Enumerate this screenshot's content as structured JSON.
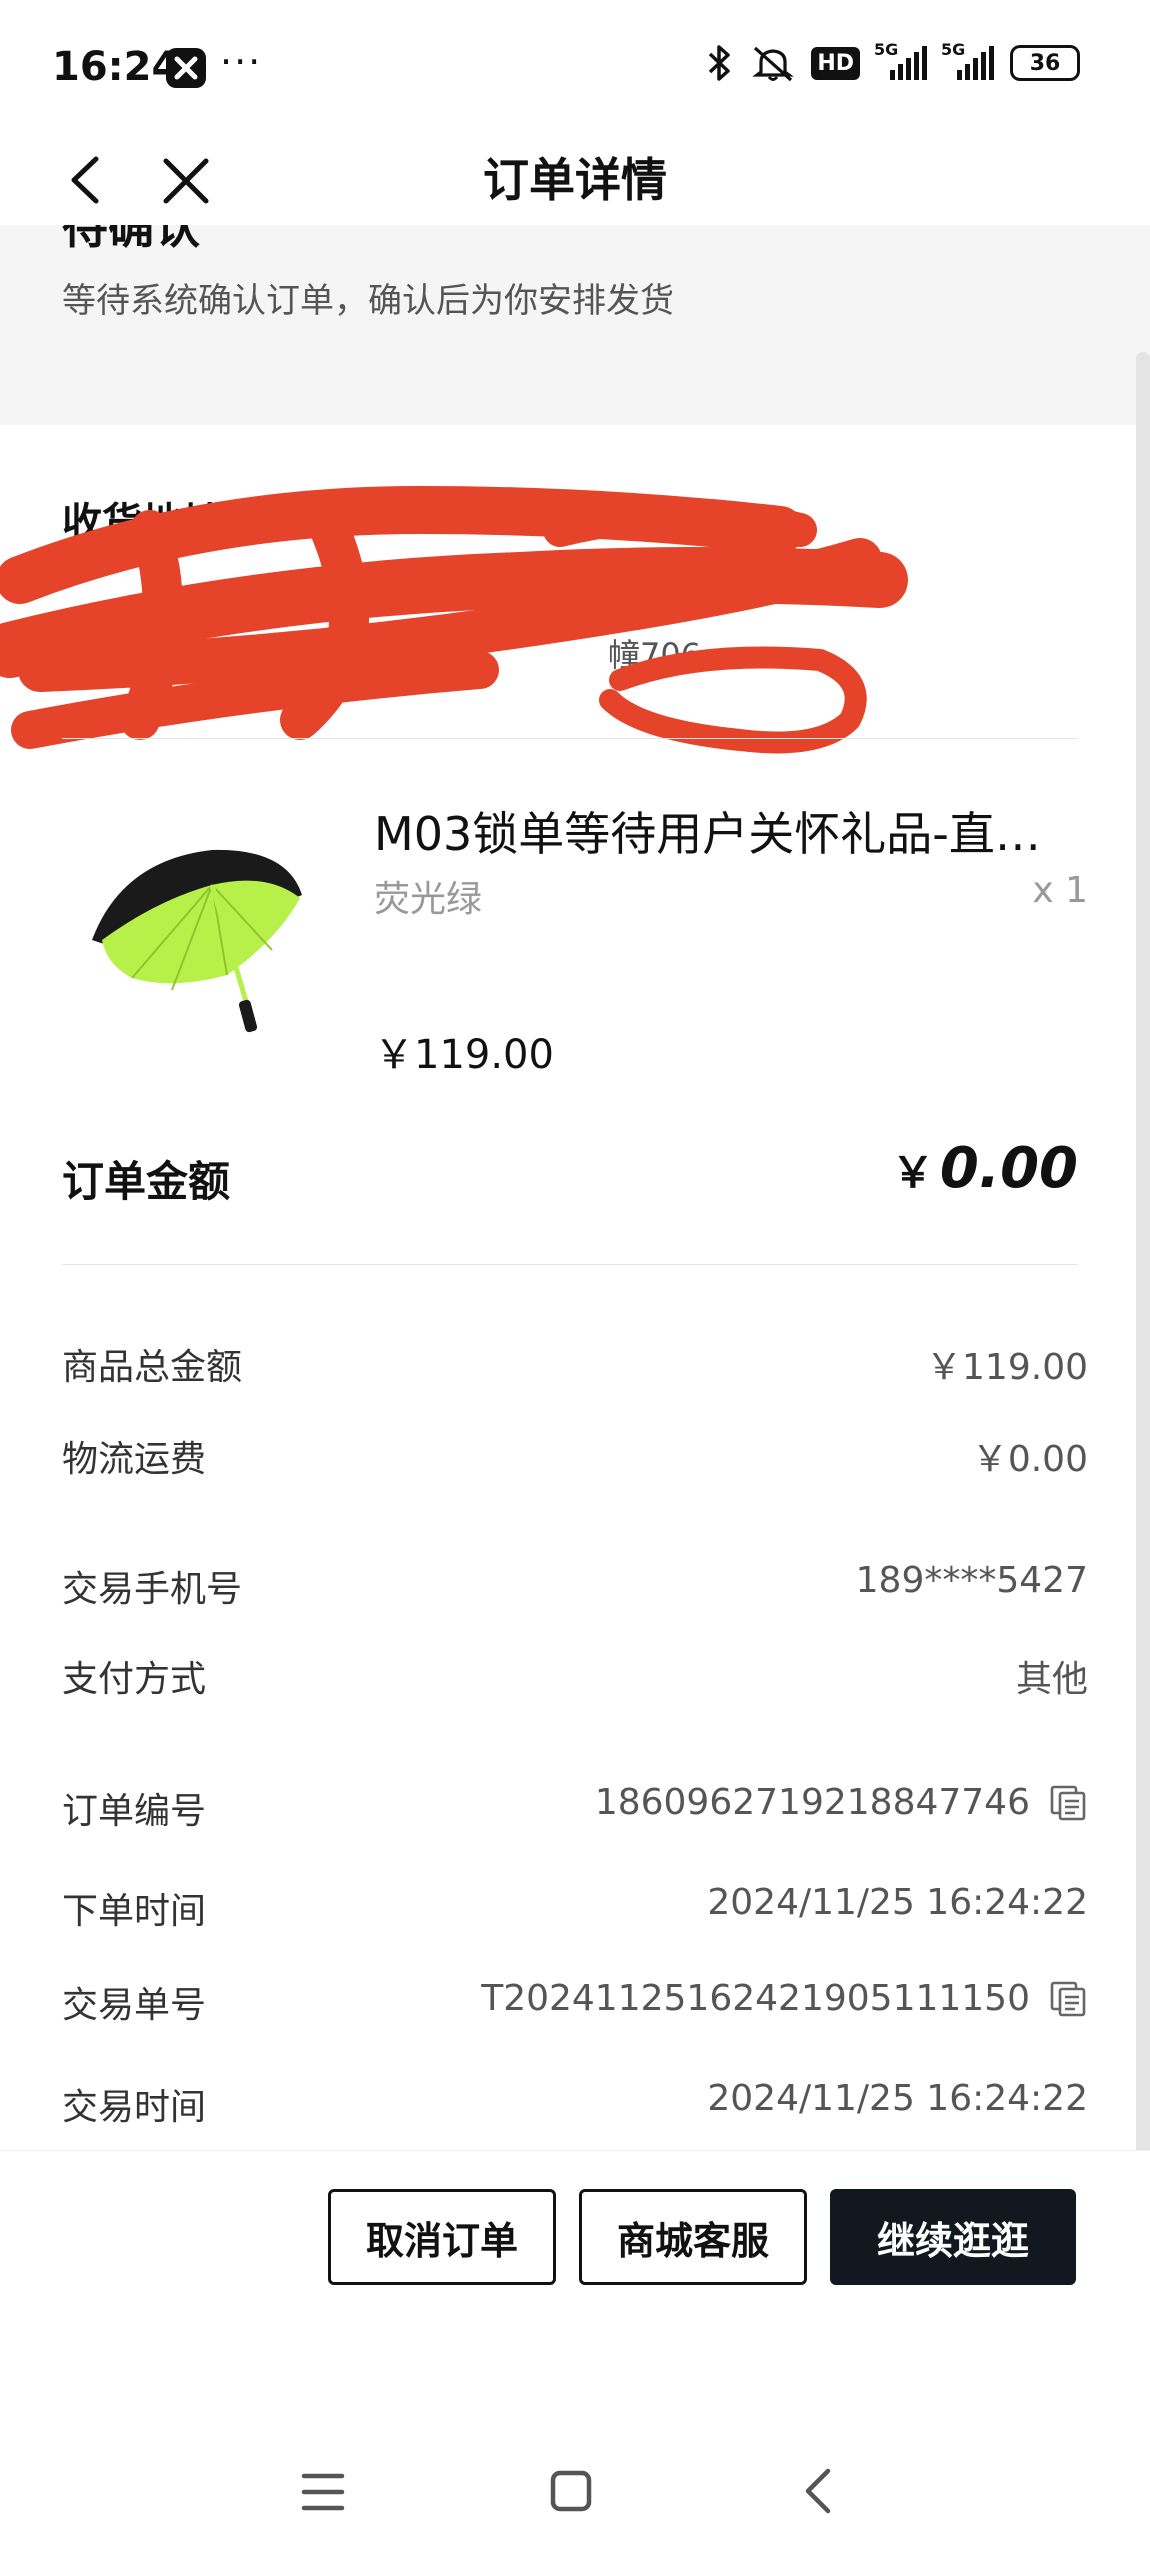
{
  "status_bar": {
    "time": "16:24",
    "more": "···",
    "icons": [
      "bluetooth-icon",
      "mute-icon",
      "hd-icon",
      "signal-5g-icon",
      "signal-5g-icon",
      "battery-icon"
    ],
    "hd": "HD",
    "network_1": "5G",
    "network_2": "5G",
    "battery": "36"
  },
  "nav": {
    "title": "订单详情",
    "back_icon": "chevron-left-icon",
    "close_icon": "close-icon"
  },
  "order_status": {
    "title": "待确认",
    "subtitle": "等待系统确认订单，确认后为你安排发货"
  },
  "address": {
    "title": "收货地址",
    "line1": "",
    "line2": "幢706"
  },
  "product": {
    "name": "M03锁单等待用户关怀礼品-直…",
    "variant": "荧光绿",
    "quantity": "x 1",
    "price": "￥119.00",
    "colors": {
      "canopy_inner": "#b8f04a",
      "canopy_outer": "#1a1a1a"
    }
  },
  "order_total": {
    "label": "订单金额",
    "currency": "￥",
    "amount": "0.00"
  },
  "cost_rows": [
    {
      "label": "商品总金额",
      "value": "￥119.00"
    },
    {
      "label": "物流运费",
      "value": "￥0.00"
    }
  ],
  "payment_rows": [
    {
      "label": "交易手机号",
      "value": "189****5427"
    },
    {
      "label": "支付方式",
      "value": "其他"
    }
  ],
  "info_rows": [
    {
      "label": "订单编号",
      "value": "1860962719218847746",
      "copy": true
    },
    {
      "label": "下单时间",
      "value": "2024/11/25 16:24:22",
      "copy": false
    },
    {
      "label": "交易单号",
      "value": "T20241125162421905111150",
      "copy": true
    },
    {
      "label": "交易时间",
      "value": "2024/11/25 16:24:22",
      "copy": false
    }
  ],
  "actions": {
    "cancel": "取消订单",
    "service": "商城客服",
    "continue": "继续逛逛"
  },
  "system_nav": [
    "menu-icon",
    "home-icon",
    "back-icon"
  ],
  "colors": {
    "primary_button": "#111820",
    "redaction": "#e5432a",
    "panel_bg": "#f5f5f5"
  }
}
